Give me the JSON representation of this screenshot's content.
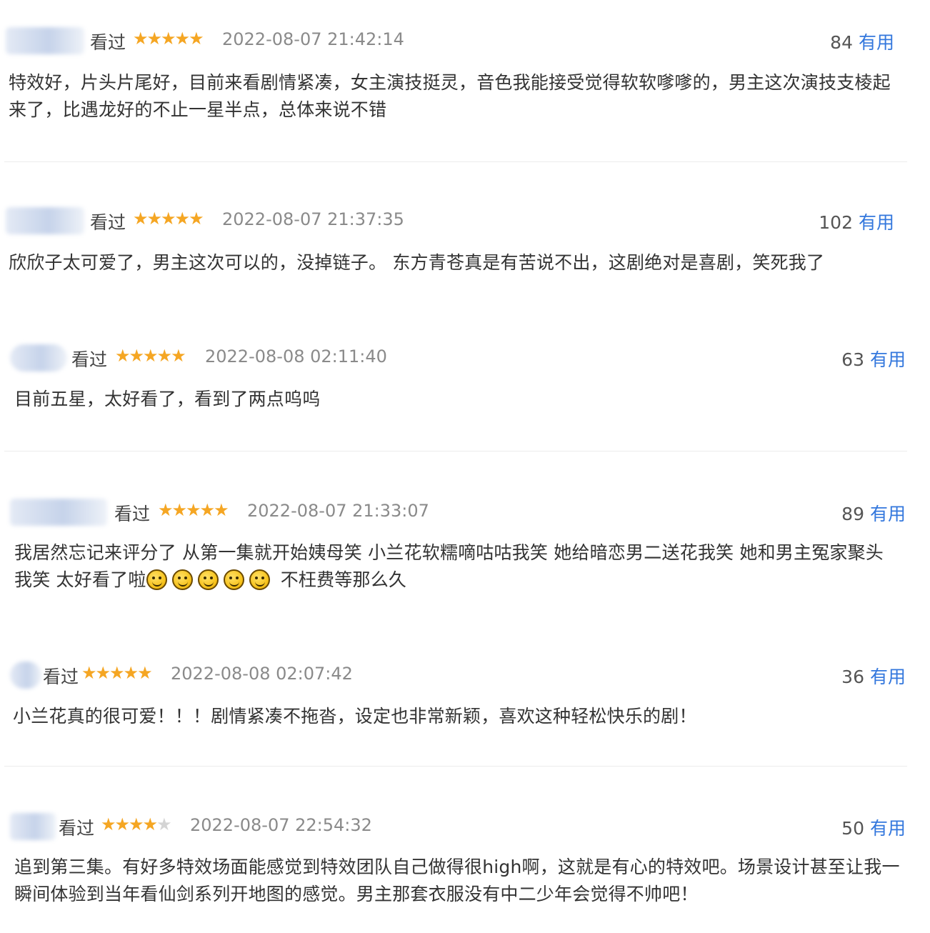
{
  "reviews": [
    {
      "user_suffix": "▌",
      "status": "看过",
      "rating": 5,
      "time": "2022-08-07 21:42:14",
      "useful_count": "84",
      "useful_label": "有用",
      "text": "特效好，片头片尾好，目前来看剧情紧凑，女主演技挺灵，音色我能接受觉得软软嗲嗲的，男主这次演技支棱起来了，比遇龙好的不止一星半点，总体来说不错"
    },
    {
      "user_suffix": "",
      "status": "看过",
      "rating": 5,
      "time": "2022-08-07 21:37:35",
      "useful_count": "102",
      "useful_label": "有用",
      "text": "欣欣子太可爱了，男主这次可以的，没掉链子。 东方青苍真是有苦说不出，这剧绝对是喜剧，笑死我了"
    },
    {
      "user_suffix": "",
      "status": "看过",
      "rating": 5,
      "time": "2022-08-08 02:11:40",
      "useful_count": "63",
      "useful_label": "有用",
      "text": "目前五星，太好看了，看到了两点呜呜"
    },
    {
      "user_suffix": "",
      "status": "看过",
      "rating": 5,
      "time": "2022-08-07 21:33:07",
      "useful_count": "89",
      "useful_label": "有用",
      "text_before": "我居然忘记来评分了 从第一集就开始姨母笑 小兰花软糯嘀咕咕我笑 她给暗恋男二送花我笑 她和男主冤家聚头我笑 太好看了啦",
      "emoji_count": 5,
      "text_after": " 不枉费等那么久"
    },
    {
      "user_suffix": "",
      "status": "看过",
      "rating": 5,
      "time": "2022-08-08 02:07:42",
      "useful_count": "36",
      "useful_label": "有用",
      "text": "小兰花真的很可爱！！！剧情紧凑不拖沓，设定也非常新颖，喜欢这种轻松快乐的剧！"
    },
    {
      "user_suffix": "",
      "status": "看过",
      "rating": 4,
      "time": "2022-08-07 22:54:32",
      "useful_count": "50",
      "useful_label": "有用",
      "text": "追到第三集。有好多特效场面能感觉到特效团队自己做得很high啊，这就是有心的特效吧。场景设计甚至让我一瞬间体验到当年看仙剑系列开地图的感觉。男主那套衣服没有中二少年会觉得不帅吧！"
    }
  ],
  "colors": {
    "star": "#f5a623",
    "star_empty": "#d4d4d4",
    "useful_label": "#3377dd",
    "time": "#8a8a8a"
  },
  "icons": {
    "star": "star-icon",
    "emoji": "smile-emoji-icon"
  }
}
